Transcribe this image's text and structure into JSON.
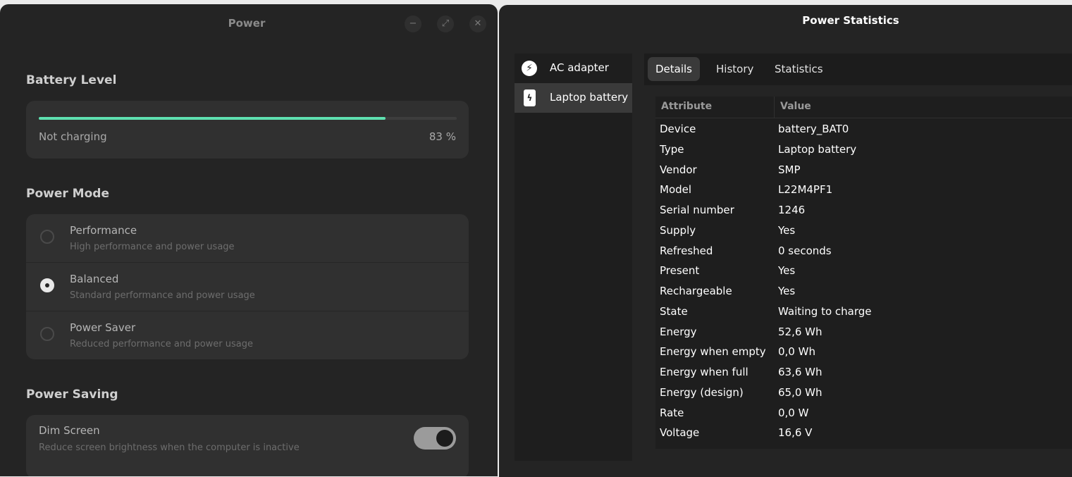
{
  "power_window": {
    "title": "Power",
    "controls": {
      "minimize": "−",
      "maximize": "⤢",
      "close": "✕"
    },
    "battery": {
      "section_title": "Battery Level",
      "level_percent": 83,
      "status": "Not charging",
      "percent_label": "83 %",
      "bar_color": "#5ee0b0"
    },
    "power_mode": {
      "section_title": "Power Mode",
      "selected": "Balanced",
      "options": [
        {
          "label": "Performance",
          "description": "High performance and power usage"
        },
        {
          "label": "Balanced",
          "description": "Standard performance and power usage"
        },
        {
          "label": "Power Saver",
          "description": "Reduced performance and power usage"
        }
      ]
    },
    "power_saving": {
      "section_title": "Power Saving",
      "dim_screen": {
        "label": "Dim Screen",
        "description": "Reduce screen brightness when the computer is inactive",
        "enabled": true
      }
    }
  },
  "stats_window": {
    "title": "Power Statistics",
    "devices": [
      {
        "label": "AC adapter",
        "icon": "lightning-icon",
        "glyph": "⚡"
      },
      {
        "label": "Laptop battery",
        "icon": "battery-charging-icon",
        "glyph": "ϟ"
      }
    ],
    "selected_device": "Laptop battery",
    "tabs": [
      "Details",
      "History",
      "Statistics"
    ],
    "active_tab": "Details",
    "table": {
      "headers": [
        "Attribute",
        "Value"
      ],
      "rows": [
        [
          "Device",
          "battery_BAT0"
        ],
        [
          "Type",
          "Laptop battery"
        ],
        [
          "Vendor",
          "SMP"
        ],
        [
          "Model",
          "L22M4PF1"
        ],
        [
          "Serial number",
          "1246"
        ],
        [
          "Supply",
          "Yes"
        ],
        [
          "Refreshed",
          "0 seconds"
        ],
        [
          "Present",
          "Yes"
        ],
        [
          "Rechargeable",
          "Yes"
        ],
        [
          "State",
          "Waiting to charge"
        ],
        [
          "Energy",
          "52,6 Wh"
        ],
        [
          "Energy when empty",
          "0,0 Wh"
        ],
        [
          "Energy when full",
          "63,6 Wh"
        ],
        [
          "Energy (design)",
          "65,0 Wh"
        ],
        [
          "Rate",
          "0,0 W"
        ],
        [
          "Voltage",
          "16,6 V"
        ]
      ]
    }
  }
}
